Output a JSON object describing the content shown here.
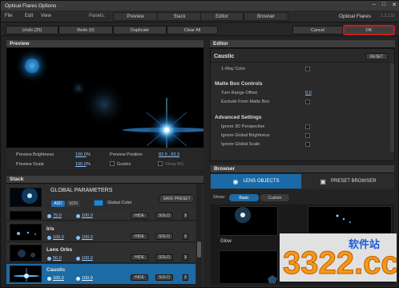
{
  "window": {
    "title": "Optical Flares Options"
  },
  "menu": {
    "file": "File",
    "edit": "Edit",
    "view": "View"
  },
  "panels": {
    "label": "Panels:",
    "tabs": [
      "Preview",
      "Stack",
      "Editor",
      "Browser"
    ]
  },
  "brand": {
    "name": "Optical Flares",
    "version": "1.2.132"
  },
  "toolbar": {
    "undo": "Undo (25)",
    "redo": "Redo (0)",
    "duplicate": "Duplicate",
    "clear_all": "Clear All",
    "cancel": "Cancel",
    "ok": "OK"
  },
  "preview": {
    "header": "Preview",
    "brightness_label": "Preview Brightness",
    "brightness_value": "100.0",
    "brightness_unit": "%",
    "scale_label": "Preview Scale",
    "scale_value": "100.0",
    "scale_unit": "%",
    "position_label": "Preview Position",
    "position_value": "82.9 , 83.3",
    "guides_label": "Guides",
    "showbg_label": "Show BG"
  },
  "editor": {
    "header": "Editor",
    "title": "Caustic",
    "reset": "RESET",
    "row_1way": "1-Way Color",
    "section_matte": "Matte Box Controls",
    "range_offset_label": "Turn Range Offset",
    "range_offset_value": "0.0",
    "exclude_matte": "Exclude From Matte Box",
    "section_advanced": "Advanced Settings",
    "ignore_3d": "Ignore 3D Perspective",
    "ignore_brightness": "Ignore Global Brightness",
    "ignore_scale": "Ignore Global Scale"
  },
  "stack": {
    "header": "Stack",
    "global_title": "GLOBAL PARAMETERS",
    "add": "ADD",
    "scn": "SCN",
    "global_color": "Global Color",
    "save_preset": "SAVE PRESET",
    "hide": "HIDE",
    "solo": "SOLO",
    "x": "X",
    "rows": [
      {
        "name": "",
        "v1": "75.0",
        "v2": "100.0"
      },
      {
        "name": "Iris",
        "v1": "100.0",
        "v2": "100.0"
      },
      {
        "name": "Lens Orbs",
        "v1": "50.0",
        "v2": "100.0"
      },
      {
        "name": "Caustic",
        "v1": "100.0",
        "v2": "100.0"
      }
    ]
  },
  "browser": {
    "header": "Browser",
    "lens_objects": "LENS OBJECTS",
    "preset_browser": "PRESET BROWSER",
    "show": "Show:",
    "basic": "Basic",
    "custom": "Custom",
    "item1": "Glow"
  },
  "watermark": {
    "main": "3322.cc",
    "sub": "软件站"
  },
  "colors": {
    "accent": "#1b6aa8",
    "ok_border": "#c81c1c",
    "link": "#8fc6ff"
  }
}
